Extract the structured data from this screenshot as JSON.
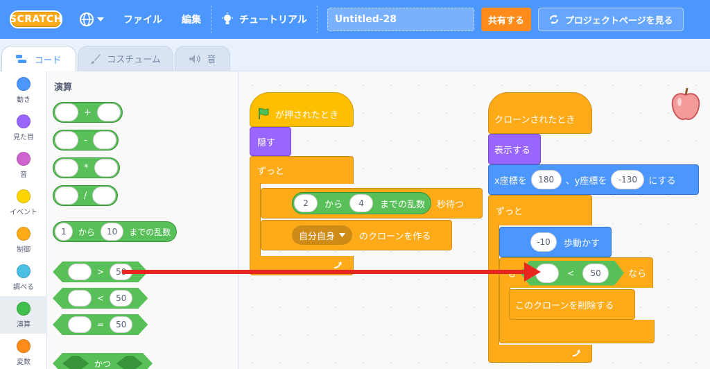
{
  "menubar": {
    "logo": "SCRATCH",
    "language_icon": "globe-icon",
    "file": "ファイル",
    "edit": "編集",
    "tutorial": "チュートリアル",
    "project_title": "Untitled-28",
    "share": "共有する",
    "project_page": "プロジェクトページを見る"
  },
  "tabs": [
    {
      "label": "コード",
      "icon": "code-icon"
    },
    {
      "label": "コスチューム",
      "icon": "brush-icon"
    },
    {
      "label": "音",
      "icon": "speaker-icon"
    }
  ],
  "categories": [
    {
      "label": "動き",
      "color": "#4c97ff"
    },
    {
      "label": "見た目",
      "color": "#9966ff"
    },
    {
      "label": "音",
      "color": "#cf63cf"
    },
    {
      "label": "イベント",
      "color": "#ffd500"
    },
    {
      "label": "制御",
      "color": "#ffab19"
    },
    {
      "label": "調べる",
      "color": "#4cbfe6"
    },
    {
      "label": "演算",
      "color": "#40bf4a"
    },
    {
      "label": "変数",
      "color": "#ff8c1a"
    }
  ],
  "palette": {
    "title": "演算",
    "ops": [
      "+",
      "-",
      "*",
      "/"
    ],
    "random": {
      "from": "1",
      "from_label": "から",
      "to": "10",
      "to_label": "までの乱数"
    },
    "compare": [
      {
        "op": ">",
        "value": "50"
      },
      {
        "op": "<",
        "value": "50"
      },
      {
        "op": "=",
        "value": "50"
      }
    ],
    "and_label": "かつ"
  },
  "script1": {
    "hat": "が押されたとき",
    "hide": "隠す",
    "forever": "ずっと",
    "wait_from": "2",
    "wait_from_label": "から",
    "wait_to": "4",
    "wait_to_label": "までの乱数",
    "wait_label": "秒待つ",
    "clone_target": "自分自身",
    "clone_label": "のクローンを作る"
  },
  "script2": {
    "hat": "クローンされたとき",
    "show": "表示する",
    "goto_x_label": "x座標を",
    "goto_x": "180",
    "goto_y_label": "、y座標を",
    "goto_y": "-130",
    "goto_suffix": "にする",
    "forever": "ずっと",
    "move_value": "-10",
    "move_label": "歩動かす",
    "if_prefix": "も",
    "if_op": "<",
    "if_value": "50",
    "if_suffix": "なら",
    "delete_clone": "このクローンを削除する"
  },
  "colors": {
    "menubar": "#4c97ff",
    "operators": "#59c059",
    "events": "#ffbf00",
    "control": "#ffab19",
    "looks": "#9966ff",
    "motion": "#4c97ff",
    "arrow": "#e8251f"
  }
}
